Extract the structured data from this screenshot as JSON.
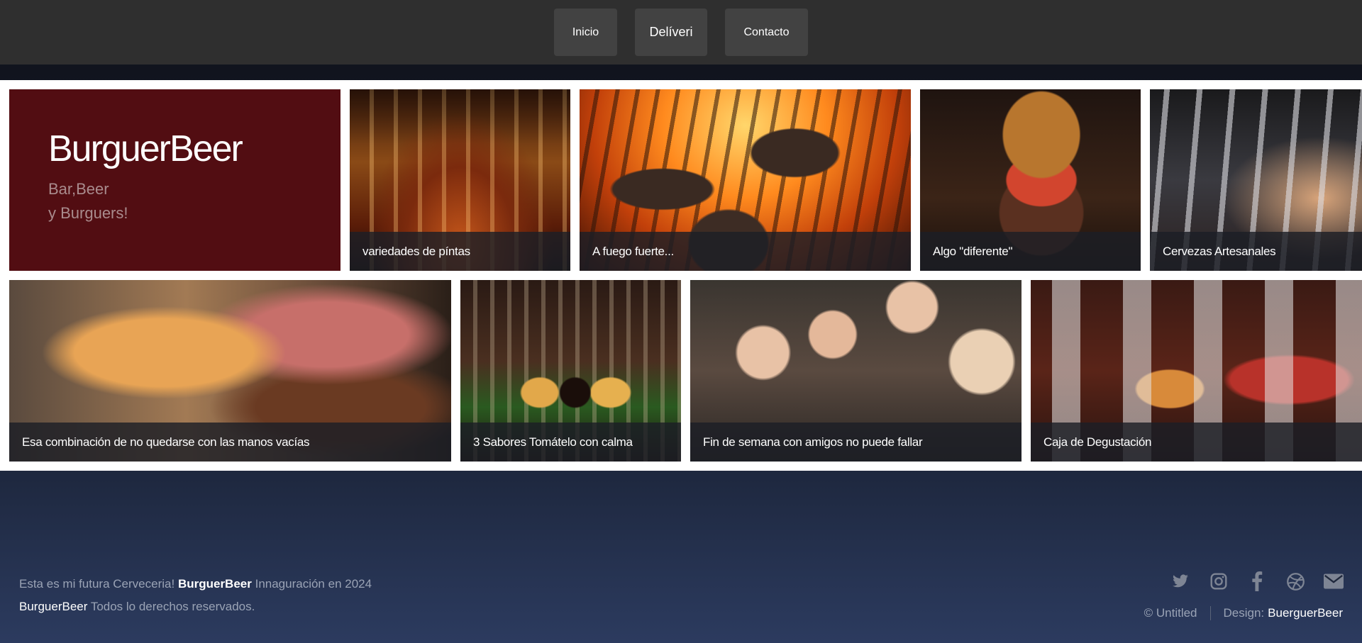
{
  "nav": {
    "items": [
      "Inicio",
      "Delíveri",
      "Contacto"
    ]
  },
  "brand": {
    "title": "BurguerBeer",
    "subtitle_line1": "Bar,Beer",
    "subtitle_line2": "y Burguers!"
  },
  "gallery": {
    "row1": [
      {
        "caption": "variedades de píntas"
      },
      {
        "caption": "A fuego fuerte..."
      },
      {
        "caption": "Algo \"diferente\""
      },
      {
        "caption": "Cervezas Artesanales"
      }
    ],
    "row2": [
      {
        "caption": "Esa combinación de no quedarse con las manos vacías"
      },
      {
        "caption": "3 Sabores Tomátelo con calma"
      },
      {
        "caption": "Fin de semana con amigos no puede fallar"
      },
      {
        "caption": "Caja de Degustación"
      }
    ]
  },
  "footer": {
    "line1_prefix": "Esta es mi futura Cerveceria!",
    "line1_brand": "BurguerBeer",
    "line1_suffix": "Innaguración en 2024",
    "line2_brand": "BurguerBeer",
    "line2_suffix": "Todos lo derechos reservados.",
    "copyright": "© Untitled",
    "design_label": "Design:",
    "designer": "BuerguerBeer",
    "social_icons": [
      "twitter-icon",
      "instagram-icon",
      "facebook-icon",
      "dribbble-icon",
      "email-icon"
    ]
  }
}
